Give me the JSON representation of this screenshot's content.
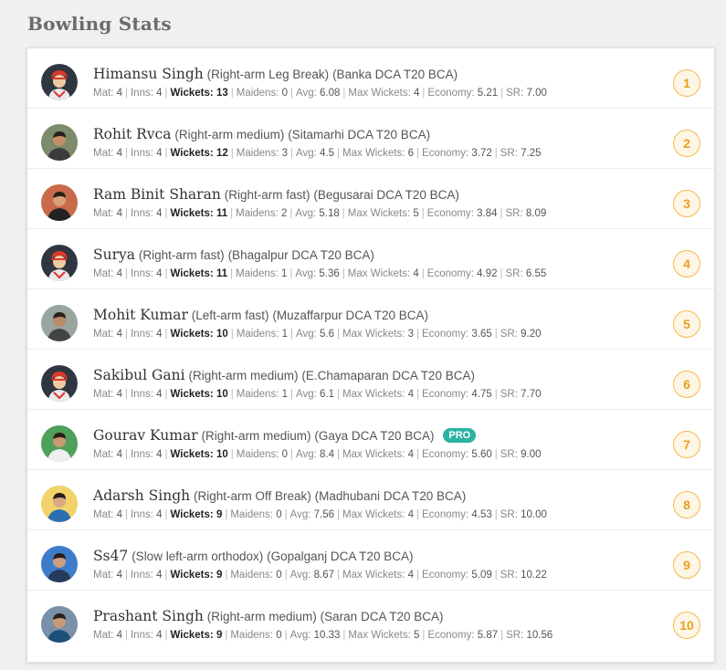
{
  "page_title": "Bowling Stats",
  "labels": {
    "mat": "Mat:",
    "inns": "Inns:",
    "wickets": "Wickets:",
    "maidens": "Maidens:",
    "avg": "Avg:",
    "max_wickets": "Max Wickets:",
    "economy": "Economy:",
    "sr": "SR:"
  },
  "colors": {
    "rank_border": "#f4b84a",
    "rank_text": "#e8a020",
    "pro_badge": "#2bb3a3"
  },
  "players": [
    {
      "rank": "1",
      "name": "Himansu Singh",
      "role": "(Right-arm Leg Break)",
      "team": "(Banka DCA T20 BCA)",
      "badge": "",
      "avatar": "default-avatar-icon",
      "mat": "4",
      "inns": "4",
      "wickets": "13",
      "maidens": "0",
      "avg": "6.08",
      "max_wickets": "4",
      "economy": "5.21",
      "sr": "7.00"
    },
    {
      "rank": "2",
      "name": "Rohit Rvca",
      "role": "(Right-arm medium)",
      "team": "(Sitamarhi DCA T20 BCA)",
      "badge": "",
      "avatar": "user-photo",
      "mat": "4",
      "inns": "4",
      "wickets": "12",
      "maidens": "3",
      "avg": "4.5",
      "max_wickets": "6",
      "economy": "3.72",
      "sr": "7.25"
    },
    {
      "rank": "3",
      "name": "Ram Binit Sharan",
      "role": "(Right-arm fast)",
      "team": "(Begusarai DCA T20 BCA)",
      "badge": "",
      "avatar": "user-photo",
      "mat": "4",
      "inns": "4",
      "wickets": "11",
      "maidens": "2",
      "avg": "5.18",
      "max_wickets": "5",
      "economy": "3.84",
      "sr": "8.09"
    },
    {
      "rank": "4",
      "name": "Surya",
      "role": "(Right-arm fast)",
      "team": "(Bhagalpur DCA T20 BCA)",
      "badge": "",
      "avatar": "default-avatar-icon",
      "mat": "4",
      "inns": "4",
      "wickets": "11",
      "maidens": "1",
      "avg": "5.36",
      "max_wickets": "4",
      "economy": "4.92",
      "sr": "6.55"
    },
    {
      "rank": "5",
      "name": "Mohit Kumar",
      "role": "(Left-arm fast)",
      "team": "(Muzaffarpur DCA T20 BCA)",
      "badge": "",
      "avatar": "user-photo",
      "mat": "4",
      "inns": "4",
      "wickets": "10",
      "maidens": "1",
      "avg": "5.6",
      "max_wickets": "3",
      "economy": "3.65",
      "sr": "9.20"
    },
    {
      "rank": "6",
      "name": "Sakibul Gani",
      "role": "(Right-arm medium)",
      "team": "(E.Chamaparan DCA T20 BCA)",
      "badge": "",
      "avatar": "default-avatar-icon",
      "mat": "4",
      "inns": "4",
      "wickets": "10",
      "maidens": "1",
      "avg": "6.1",
      "max_wickets": "4",
      "economy": "4.75",
      "sr": "7.70"
    },
    {
      "rank": "7",
      "name": "Gourav Kumar",
      "role": "(Right-arm medium)",
      "team": "(Gaya DCA T20 BCA)",
      "badge": "PRO",
      "avatar": "user-photo",
      "mat": "4",
      "inns": "4",
      "wickets": "10",
      "maidens": "0",
      "avg": "8.4",
      "max_wickets": "4",
      "economy": "5.60",
      "sr": "9.00"
    },
    {
      "rank": "8",
      "name": "Adarsh Singh",
      "role": "(Right-arm Off Break)",
      "team": "(Madhubani DCA T20 BCA)",
      "badge": "",
      "avatar": "user-photo",
      "mat": "4",
      "inns": "4",
      "wickets": "9",
      "maidens": "0",
      "avg": "7.56",
      "max_wickets": "4",
      "economy": "4.53",
      "sr": "10.00"
    },
    {
      "rank": "9",
      "name": "Ss47",
      "role": "(Slow left-arm orthodox)",
      "team": "(Gopalganj DCA T20 BCA)",
      "badge": "",
      "avatar": "user-photo",
      "mat": "4",
      "inns": "4",
      "wickets": "9",
      "maidens": "0",
      "avg": "8.67",
      "max_wickets": "4",
      "economy": "5.09",
      "sr": "10.22"
    },
    {
      "rank": "10",
      "name": "Prashant Singh",
      "role": "(Right-arm medium)",
      "team": "(Saran DCA T20 BCA)",
      "badge": "",
      "avatar": "user-photo",
      "mat": "4",
      "inns": "4",
      "wickets": "9",
      "maidens": "0",
      "avg": "10.33",
      "max_wickets": "5",
      "economy": "5.87",
      "sr": "10.56"
    }
  ]
}
